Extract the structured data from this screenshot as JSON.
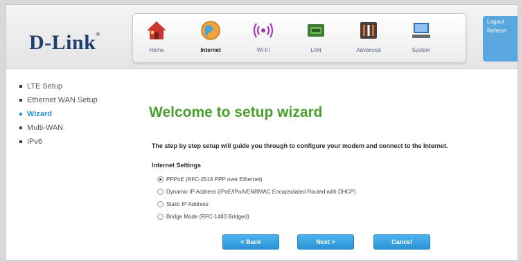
{
  "brand": {
    "logo_text": "D-Link",
    "trademark": "®"
  },
  "nav": [
    {
      "id": "home",
      "label": "Home",
      "icon": "home-icon"
    },
    {
      "id": "internet",
      "label": "Internet",
      "icon": "globe-icon",
      "active": true
    },
    {
      "id": "wifi",
      "label": "Wi-Fi",
      "icon": "wifi-icon"
    },
    {
      "id": "lan",
      "label": "LAN",
      "icon": "lan-icon"
    },
    {
      "id": "advanced",
      "label": "Advanced",
      "icon": "advanced-icon"
    },
    {
      "id": "system",
      "label": "System",
      "icon": "system-icon"
    }
  ],
  "side_panel": {
    "logout": "Logout",
    "refresh": "Refresh"
  },
  "sidebar": {
    "items": [
      {
        "label": "LTE Setup"
      },
      {
        "label": "Ethernet WAN Setup"
      },
      {
        "label": "Wizard",
        "active": true
      },
      {
        "label": "Multi-WAN"
      },
      {
        "label": "IPv6"
      }
    ]
  },
  "main": {
    "title": "Welcome to setup wizard",
    "description": "The step by step setup will guide you through to configure your modem and connect to the Internet.",
    "settings_heading": "Internet Settings",
    "options": [
      {
        "label": "PPPoE (RFC-2516 PPP over Ethernet)",
        "checked": true
      },
      {
        "label": "Dynamic IP Address (IPoE/IPoA/ENRMAC Encapsulated Routed with DHCP)",
        "checked": false
      },
      {
        "label": "Static IP Address",
        "checked": false
      },
      {
        "label": "Bridge Mode (RFC-1483 Bridged)",
        "checked": false
      }
    ],
    "buttons": {
      "back": "< Back",
      "next": "Next >",
      "cancel": "Cancel"
    }
  },
  "colors": {
    "accent_blue": "#2d8ed9",
    "title_green": "#4aa02c",
    "logo_navy": "#1e3f70"
  }
}
